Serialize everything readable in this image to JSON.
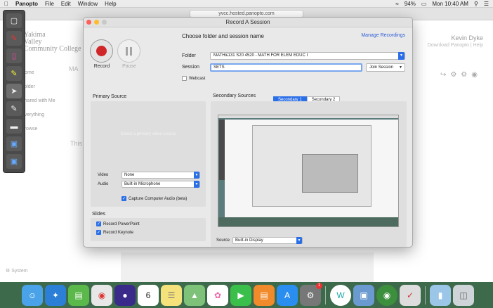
{
  "menubar": {
    "app": "Panopto",
    "menus": [
      "File",
      "Edit",
      "Window",
      "Help"
    ],
    "battery": "94%",
    "clock": "Mon 10:40 AM"
  },
  "browser": {
    "url": "yvcc.hosted.panopto.com",
    "logo_line1": "Yakima",
    "logo_line2": "Valley",
    "logo_line3": "Community College",
    "nav": [
      "Home",
      "Folder",
      "Shared with Me",
      "Everything"
    ],
    "nav_active": "Browse",
    "user_name": "Kevin Dyke",
    "download": "Download Panopto",
    "help": "Help",
    "ghost_text": "This",
    "system": "System",
    "ma": "MA"
  },
  "dialog": {
    "title": "Record A Session",
    "record_label": "Record",
    "pause_label": "Pause",
    "choose_label": "Choose folder and session name",
    "manage_link": "Manage Recordings",
    "folder_label": "Folder",
    "folder_value": "MATH&131  S20  4520 - MATH FOR ELEM EDUC I",
    "session_label": "Session",
    "session_value": "SETS",
    "join_label": "Join Session",
    "webcast_label": "Webcast",
    "primary_title": "Primary Source",
    "primary_msg": "Select a primary video source",
    "video_label": "Video",
    "video_value": "None",
    "audio_label": "Audio",
    "audio_value": "Built-in Microphone",
    "capture_audio": "Capture Computer Audio (beta)",
    "slides_title": "Slides",
    "record_ppt": "Record PowerPoint",
    "record_keynote": "Record Keynote",
    "secondary_title": "Secondary Sources",
    "tab1": "Secondary 1",
    "tab2": "Secondary 2",
    "source_label": "Source",
    "source_value": "Built-in Display"
  },
  "colors": {
    "accent": "#2a6ee8",
    "record_red": "#d0262a"
  },
  "dock": {
    "icons": [
      "finder-icon",
      "safari-icon",
      "numbers-icon",
      "chrome-icon",
      "siri-icon",
      "calendar-icon",
      "notes-icon",
      "maps-icon",
      "photos-icon",
      "facetime-icon",
      "books-icon",
      "appstore-icon",
      "system-preferences-icon",
      "panopto-icon",
      "preview-icon",
      "globe-icon",
      "annotate-icon",
      "folder-icon",
      "trash-icon"
    ],
    "calendar_day": "6",
    "badge": "1"
  }
}
